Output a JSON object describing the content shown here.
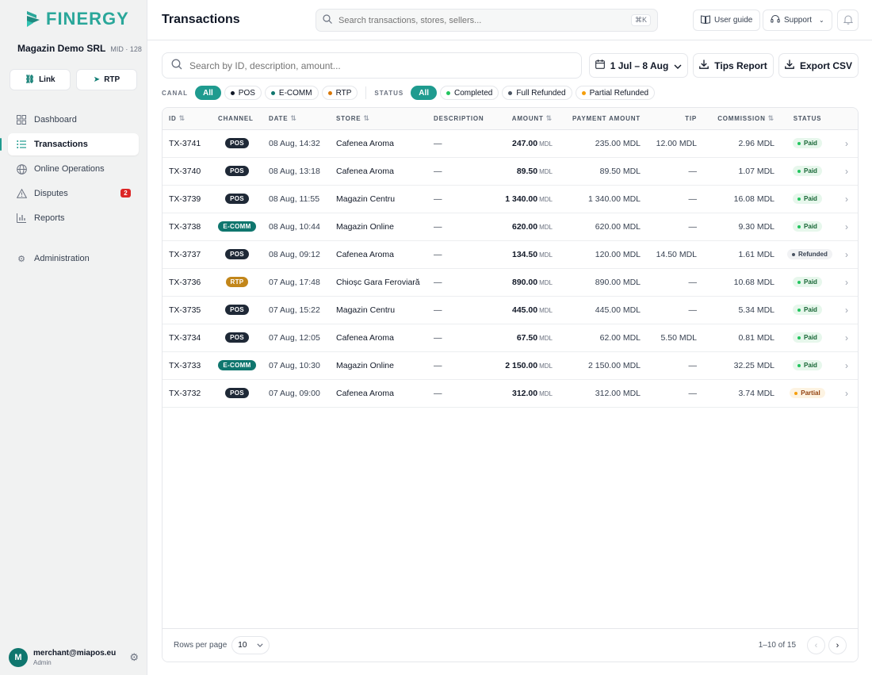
{
  "brand": {
    "name": "FINERGY",
    "color": "#2aa79a"
  },
  "merchant": {
    "name": "Magazin Demo SRL",
    "mid": "MID · 128"
  },
  "quick_actions": [
    {
      "label": "Link",
      "icon": "link-icon"
    },
    {
      "label": "RTP",
      "icon": "send-icon"
    }
  ],
  "nav": [
    {
      "label": "Dashboard",
      "icon": "grid-icon",
      "active": false
    },
    {
      "label": "Transactions",
      "icon": "list-icon",
      "active": true
    },
    {
      "label": "Online Operations",
      "icon": "globe-icon",
      "active": false
    },
    {
      "label": "Disputes",
      "icon": "alert-triangle-icon",
      "active": false,
      "badge": "2"
    },
    {
      "label": "Reports",
      "icon": "bar-chart-icon",
      "active": false
    },
    {
      "label": "Administration",
      "icon": "gear-icon",
      "active": false
    }
  ],
  "user": {
    "initial": "M",
    "email": "merchant@miapos.eu",
    "role": "Admin"
  },
  "header": {
    "title": "Transactions",
    "search_placeholder": "Search transactions, stores, sellers...",
    "shortcut": "⌘K",
    "user_guide": "User guide",
    "support": "Support"
  },
  "toolbar": {
    "search_placeholder": "Search by ID, description, amount...",
    "date_range": "1 Jul – 8 Aug",
    "tips_report": "Tips Report",
    "export_csv": "Export CSV"
  },
  "filters": {
    "canal_label": "CANAL",
    "canal": [
      {
        "label": "All",
        "active": true,
        "dot": ""
      },
      {
        "label": "POS",
        "active": false,
        "dot": "#111827"
      },
      {
        "label": "E-COMM",
        "active": false,
        "dot": "#0f766e"
      },
      {
        "label": "RTP",
        "active": false,
        "dot": "#d97706"
      }
    ],
    "status_label": "STATUS",
    "status": [
      {
        "label": "All",
        "active": true,
        "dot": ""
      },
      {
        "label": "Completed",
        "active": false,
        "dot": "#22c55e"
      },
      {
        "label": "Full Refunded",
        "active": false,
        "dot": "#4b5563"
      },
      {
        "label": "Partial Refunded",
        "active": false,
        "dot": "#f59e0b"
      }
    ]
  },
  "table": {
    "columns": [
      "ID",
      "CHANNEL",
      "DATE",
      "STORE",
      "DESCRIPTION",
      "AMOUNT",
      "PAYMENT AMOUNT",
      "TIP",
      "COMMISSION",
      "STATUS"
    ],
    "currency": "MDL",
    "rows": [
      {
        "id": "TX-3741",
        "channel": "POS",
        "date": "08 Aug, 14:32",
        "store": "Cafenea Aroma",
        "desc": "—",
        "amount": "247.00",
        "payment": "235.00 MDL",
        "tip": "12.00 MDL",
        "commission": "2.96 MDL",
        "status": "Paid"
      },
      {
        "id": "TX-3740",
        "channel": "POS",
        "date": "08 Aug, 13:18",
        "store": "Cafenea Aroma",
        "desc": "—",
        "amount": "89.50",
        "payment": "89.50 MDL",
        "tip": "—",
        "commission": "1.07 MDL",
        "status": "Paid"
      },
      {
        "id": "TX-3739",
        "channel": "POS",
        "date": "08 Aug, 11:55",
        "store": "Magazin Centru",
        "desc": "—",
        "amount": "1 340.00",
        "payment": "1 340.00 MDL",
        "tip": "—",
        "commission": "16.08 MDL",
        "status": "Paid"
      },
      {
        "id": "TX-3738",
        "channel": "E-COMM",
        "date": "08 Aug, 10:44",
        "store": "Magazin Online",
        "desc": "—",
        "amount": "620.00",
        "payment": "620.00 MDL",
        "tip": "—",
        "commission": "9.30 MDL",
        "status": "Paid"
      },
      {
        "id": "TX-3737",
        "channel": "POS",
        "date": "08 Aug, 09:12",
        "store": "Cafenea Aroma",
        "desc": "—",
        "amount": "134.50",
        "payment": "120.00 MDL",
        "tip": "14.50 MDL",
        "commission": "1.61 MDL",
        "status": "Refunded"
      },
      {
        "id": "TX-3736",
        "channel": "RTP",
        "date": "07 Aug, 17:48",
        "store": "Chioșc Gara Feroviară",
        "desc": "—",
        "amount": "890.00",
        "payment": "890.00 MDL",
        "tip": "—",
        "commission": "10.68 MDL",
        "status": "Paid"
      },
      {
        "id": "TX-3735",
        "channel": "POS",
        "date": "07 Aug, 15:22",
        "store": "Magazin Centru",
        "desc": "—",
        "amount": "445.00",
        "payment": "445.00 MDL",
        "tip": "—",
        "commission": "5.34 MDL",
        "status": "Paid"
      },
      {
        "id": "TX-3734",
        "channel": "POS",
        "date": "07 Aug, 12:05",
        "store": "Cafenea Aroma",
        "desc": "—",
        "amount": "67.50",
        "payment": "62.00 MDL",
        "tip": "5.50 MDL",
        "commission": "0.81 MDL",
        "status": "Paid"
      },
      {
        "id": "TX-3733",
        "channel": "E-COMM",
        "date": "07 Aug, 10:30",
        "store": "Magazin Online",
        "desc": "—",
        "amount": "2 150.00",
        "payment": "2 150.00 MDL",
        "tip": "—",
        "commission": "32.25 MDL",
        "status": "Paid"
      },
      {
        "id": "TX-3732",
        "channel": "POS",
        "date": "07 Aug, 09:00",
        "store": "Cafenea Aroma",
        "desc": "—",
        "amount": "312.00",
        "payment": "312.00 MDL",
        "tip": "—",
        "commission": "3.74 MDL",
        "status": "Partial"
      }
    ]
  },
  "pagination": {
    "rows_label": "Rows per page",
    "rows_value": "10",
    "range": "1–10 of 15"
  },
  "colors": {
    "accent": "#1f9b8f",
    "channel": {
      "POS": "#1f2937",
      "E-COMM": "#0f766e",
      "RTP": "#c2861a"
    },
    "status": {
      "Paid": {
        "bg": "#e7f7ec",
        "fg": "#166534",
        "dot": "#22c55e"
      },
      "Refunded": {
        "bg": "#f1f2f4",
        "fg": "#374151",
        "dot": "#4b5563"
      },
      "Partial": {
        "bg": "#fdf3e2",
        "fg": "#92400e",
        "dot": "#f59e0b"
      }
    }
  }
}
